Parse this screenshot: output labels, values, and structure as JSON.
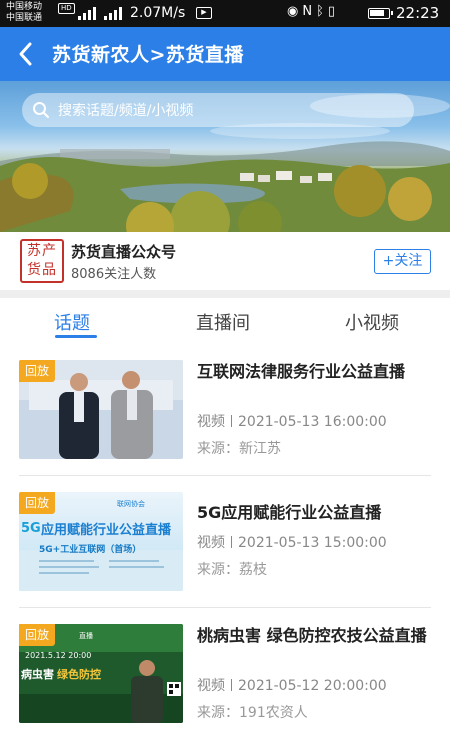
{
  "status_bar": {
    "carrier_1": "中国移动",
    "carrier_2": "中国联通",
    "hd": "HD",
    "speed": "2.07M/s",
    "media_icon": "media-icon",
    "icons": [
      "eye-icon",
      "nfc-icon",
      "bluetooth-icon",
      "vibrate-icon",
      "battery-icon"
    ],
    "time": "22:23"
  },
  "navbar": {
    "back_icon": "back-arrow-icon",
    "title": "苏货新农人>苏货直播",
    "bg_color": "#2b7fe6"
  },
  "search": {
    "icon": "search-icon",
    "placeholder": "搜索话题/频道/小视频"
  },
  "account": {
    "logo_text_top": "苏产",
    "logo_text_bottom": "货品",
    "name": "苏货直播公众号",
    "followers": "8086关注人数",
    "follow_button": "+关注"
  },
  "tabs": [
    {
      "label": "话题",
      "active": true
    },
    {
      "label": "直播间",
      "active": false
    },
    {
      "label": "小视频",
      "active": false
    }
  ],
  "items": [
    {
      "badge": "回放",
      "title": "互联网法律服务行业公益直播",
      "meta_type": "视频",
      "meta_time": "2021-05-13 16:00:00",
      "source": "来源：新江苏"
    },
    {
      "badge": "回放",
      "title": "5G应用赋能行业公益直播",
      "meta_type": "视频",
      "meta_time": "2021-05-13 15:00:00",
      "source": "来源：荔枝",
      "thumb_title": "应用赋能行业公益直播",
      "thumb_subtitle": "5G+工业互联网（首场）",
      "thumb_5g": "5G",
      "thumb_org": "联网协会"
    },
    {
      "badge": "回放",
      "title": "桃病虫害 绿色防控农技公益直播",
      "meta_type": "视频",
      "meta_time": "2021-05-12 20:00:00",
      "source": "来源：191农资人",
      "thumb_date": "2021.5.12 20:00",
      "thumb_caption_a": "病虫害",
      "thumb_caption_b": "绿色防控",
      "thumb_live": "直播"
    }
  ],
  "colors": {
    "accent": "#2b7fe6",
    "badge": "#f3a81f",
    "logo_red": "#c3322a"
  }
}
